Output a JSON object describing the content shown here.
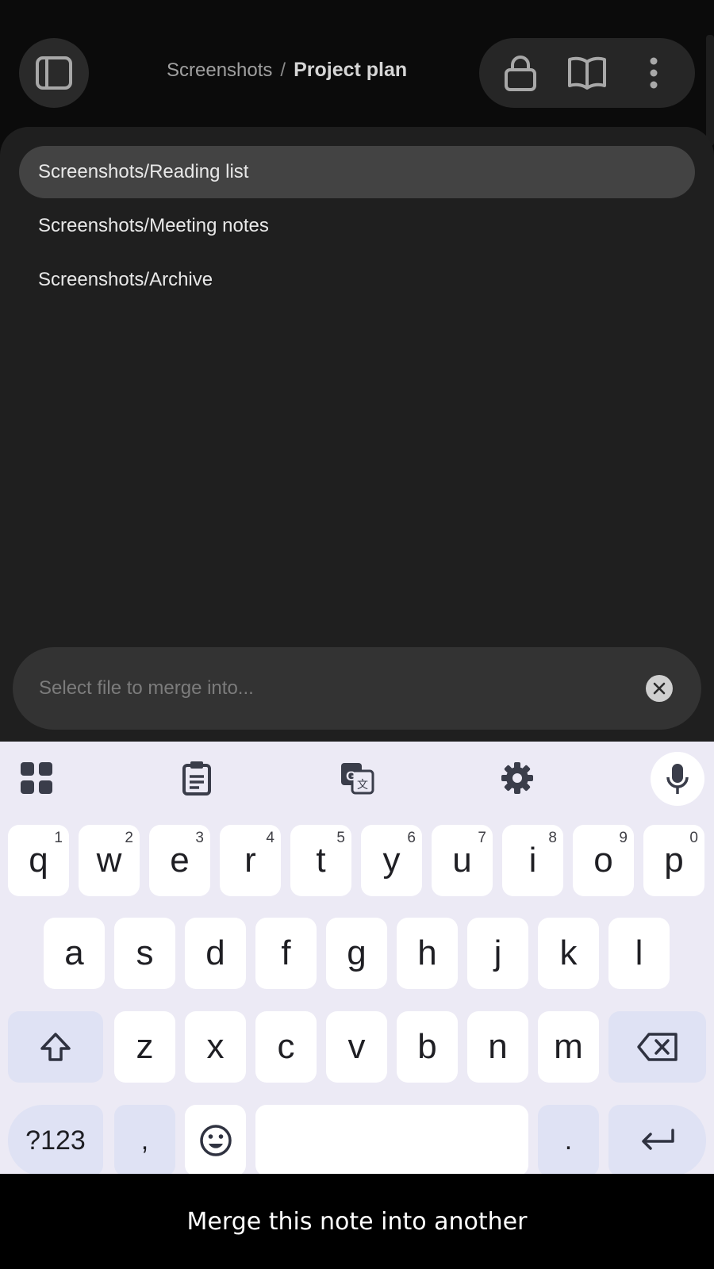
{
  "header": {
    "breadcrumb_parent": "Screenshots",
    "breadcrumb_separator": "/",
    "breadcrumb_current": "Project plan"
  },
  "suggestions": [
    {
      "label": "Screenshots/Reading list",
      "selected": true
    },
    {
      "label": "Screenshots/Meeting notes",
      "selected": false
    },
    {
      "label": "Screenshots/Archive",
      "selected": false
    }
  ],
  "search": {
    "placeholder": "Select file to merge into...",
    "value": ""
  },
  "keyboard": {
    "row1": [
      {
        "key": "q",
        "hint": "1"
      },
      {
        "key": "w",
        "hint": "2"
      },
      {
        "key": "e",
        "hint": "3"
      },
      {
        "key": "r",
        "hint": "4"
      },
      {
        "key": "t",
        "hint": "5"
      },
      {
        "key": "y",
        "hint": "6"
      },
      {
        "key": "u",
        "hint": "7"
      },
      {
        "key": "i",
        "hint": "8"
      },
      {
        "key": "o",
        "hint": "9"
      },
      {
        "key": "p",
        "hint": "0"
      }
    ],
    "row2": [
      "a",
      "s",
      "d",
      "f",
      "g",
      "h",
      "j",
      "k",
      "l"
    ],
    "row3": [
      "z",
      "x",
      "c",
      "v",
      "b",
      "n",
      "m"
    ],
    "symbols_label": "?123",
    "comma": ",",
    "period": "."
  },
  "caption": "Merge this note into another",
  "colors": {
    "background": "#0b0b0b",
    "panel": "#1f1f1f",
    "selected_row": "#434343",
    "keyboard_bg": "#eceaf5",
    "function_key": "#dfe2f4"
  }
}
